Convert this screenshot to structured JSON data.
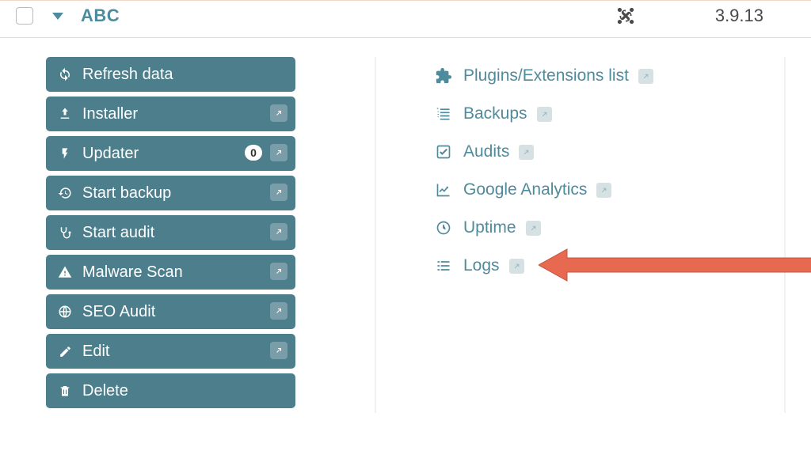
{
  "header": {
    "site_name": "ABC",
    "version": "3.9.13"
  },
  "actions": {
    "refresh": "Refresh data",
    "installer": "Installer",
    "updater": "Updater",
    "updater_badge": "0",
    "start_backup": "Start backup",
    "start_audit": "Start audit",
    "malware_scan": "Malware Scan",
    "seo_audit": "SEO Audit",
    "edit": "Edit",
    "delete": "Delete"
  },
  "links": {
    "plugins": "Plugins/Extensions list",
    "backups": "Backups",
    "audits": "Audits",
    "analytics": "Google Analytics",
    "uptime": "Uptime",
    "logs": "Logs"
  }
}
